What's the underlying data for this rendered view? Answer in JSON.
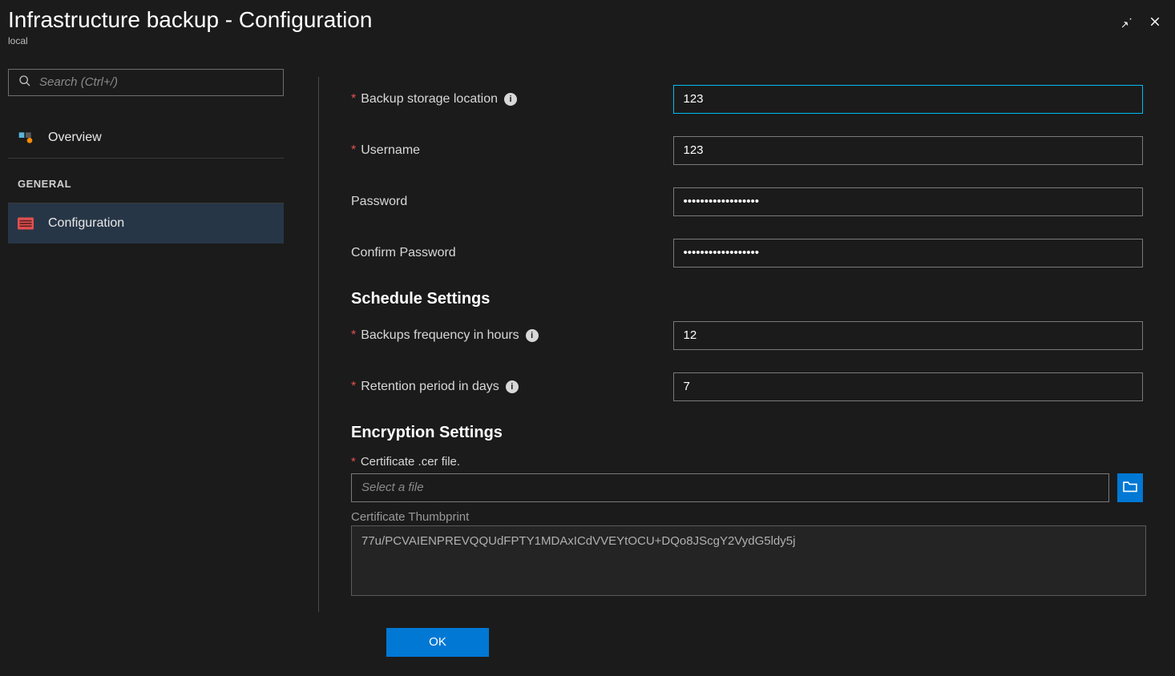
{
  "header": {
    "title": "Infrastructure backup - Configuration",
    "subtitle": "local"
  },
  "sidebar": {
    "search_placeholder": "Search (Ctrl+/)",
    "items": [
      {
        "label": "Overview",
        "selected": false
      },
      {
        "section": "GENERAL"
      },
      {
        "label": "Configuration",
        "selected": true
      }
    ]
  },
  "form": {
    "backup_location": {
      "label": "Backup storage location",
      "value": "123"
    },
    "username": {
      "label": "Username",
      "value": "123"
    },
    "password": {
      "label": "Password",
      "value": "••••••••••••••••••"
    },
    "confirm_password": {
      "label": "Confirm Password",
      "value": "••••••••••••••••••"
    },
    "schedule_heading": "Schedule Settings",
    "frequency": {
      "label": "Backups frequency in hours",
      "value": "12"
    },
    "retention": {
      "label": "Retention period in days",
      "value": "7"
    },
    "encryption_heading": "Encryption Settings",
    "cert_label": "Certificate .cer file.",
    "cert_placeholder": "Select a file",
    "thumbprint_label": "Certificate Thumbprint",
    "thumbprint_value": "77u/PCVAIENPREVQQUdFPTY1MDAxICdVVEYtOCU+DQo8JScgY2VydG5ldy5j",
    "ok_label": "OK"
  }
}
